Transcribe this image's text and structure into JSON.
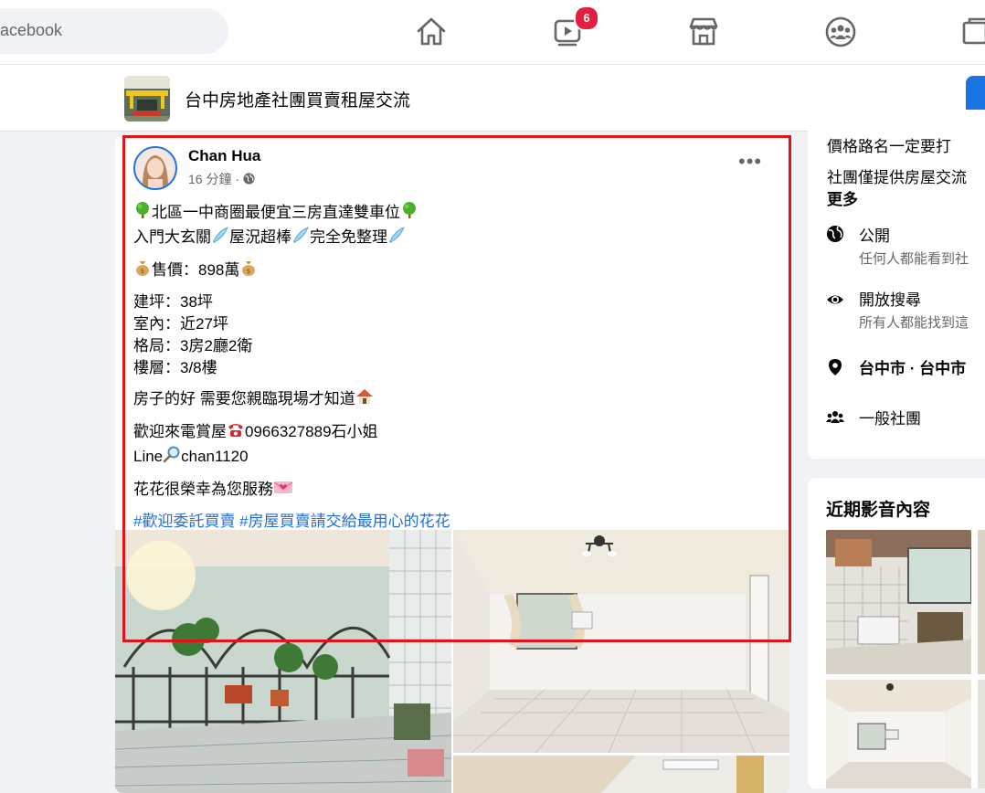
{
  "nav": {
    "search_placeholder": "acebook",
    "watch_badge": "6"
  },
  "group": {
    "name": "台中房地產社團買賣租屋交流"
  },
  "post": {
    "author": "Chan Hua",
    "time": "16 分鐘 · ",
    "more": "•••",
    "lines": {
      "l1": "北區一中商圈最便宜三房直達雙車位",
      "l2a": "入門大玄關",
      "l2b": "屋況超棒",
      "l2c": "完全免整理",
      "price": "售價：898萬",
      "area": "建坪：38坪",
      "indoor": "室內：近27坪",
      "layout": "格局：3房2廳2衛",
      "floor": "樓層：3/8樓",
      "good": "房子的好 需要您親臨現場才知道",
      "call": "歡迎來電賞屋",
      "phone": "0966327889石小姐",
      "line_a": "Line",
      "line_b": "chan1120",
      "serve": "花花很榮幸為您服務",
      "hashtags": "#歡迎委託買賣 #房屋買賣請交給最用心的花花"
    }
  },
  "about": {
    "text1": "價格路名一定要打",
    "text2": "社團僅提供房屋交流",
    "more": "更多",
    "public_title": "公開",
    "public_desc": "任何人都能看到社",
    "search_title": "開放搜尋",
    "search_desc": "所有人都能找到這",
    "location": "台中市 · 台中市",
    "type": "一般社團"
  },
  "media": {
    "title": "近期影音內容"
  }
}
